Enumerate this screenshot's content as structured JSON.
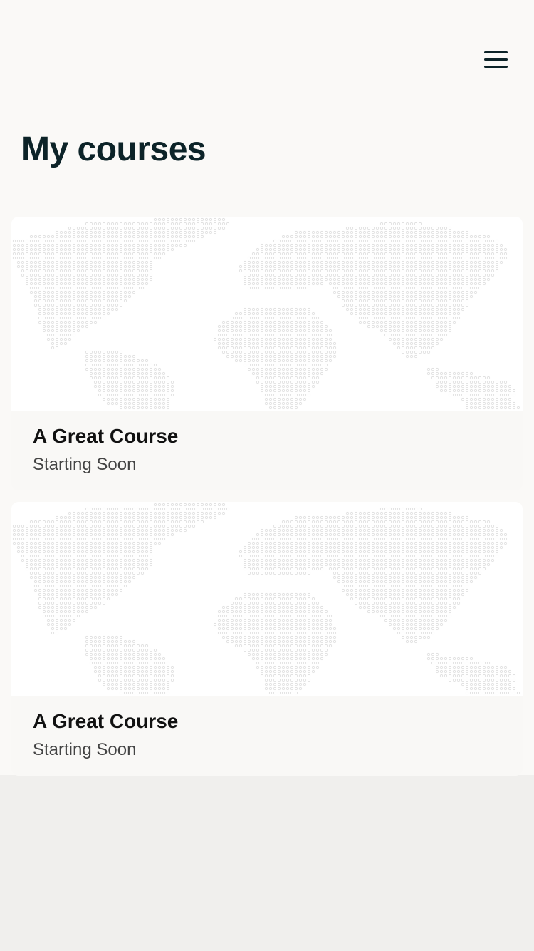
{
  "header": {
    "menu_icon": "hamburger-menu-icon"
  },
  "page": {
    "title": "My courses"
  },
  "courses": [
    {
      "name": "A Great Course",
      "status": "Starting Soon",
      "image": "world-map-dots"
    },
    {
      "name": "A Great Course",
      "status": "Starting Soon",
      "image": "world-map-dots"
    }
  ],
  "colors": {
    "title": "#0c2328",
    "page_background": "#faf9f7",
    "lower_background": "#f0efed",
    "map_dots": "#dddddd"
  }
}
